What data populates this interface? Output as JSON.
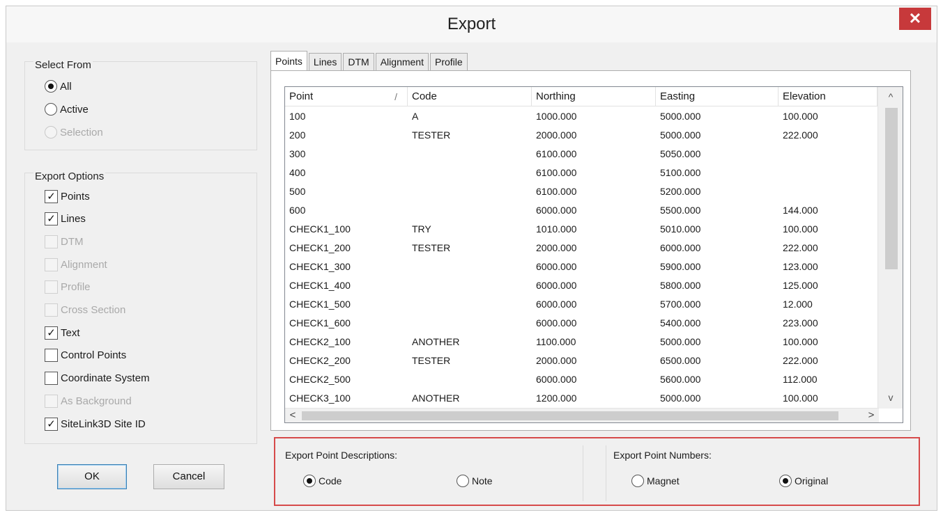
{
  "window": {
    "title": "Export",
    "close_glyph": "✕"
  },
  "select_from": {
    "label": "Select From",
    "options": [
      {
        "label": "All",
        "checked": true,
        "enabled": true
      },
      {
        "label": "Active",
        "checked": false,
        "enabled": true
      },
      {
        "label": "Selection",
        "checked": false,
        "enabled": false
      }
    ]
  },
  "export_options": {
    "label": "Export Options",
    "items": [
      {
        "label": "Points",
        "checked": true,
        "enabled": true
      },
      {
        "label": "Lines",
        "checked": true,
        "enabled": true
      },
      {
        "label": "DTM",
        "checked": false,
        "enabled": false
      },
      {
        "label": "Alignment",
        "checked": false,
        "enabled": false
      },
      {
        "label": "Profile",
        "checked": false,
        "enabled": false
      },
      {
        "label": "Cross Section",
        "checked": false,
        "enabled": false
      },
      {
        "label": "Text",
        "checked": true,
        "enabled": true
      },
      {
        "label": "Control Points",
        "checked": false,
        "enabled": true
      },
      {
        "label": "Coordinate System",
        "checked": false,
        "enabled": true
      },
      {
        "label": "As Background",
        "checked": false,
        "enabled": false
      },
      {
        "label": "SiteLink3D Site ID",
        "checked": true,
        "enabled": true
      }
    ]
  },
  "buttons": {
    "ok": "OK",
    "cancel": "Cancel"
  },
  "tabs": [
    "Points",
    "Lines",
    "DTM",
    "Alignment",
    "Profile"
  ],
  "active_tab": 0,
  "table": {
    "columns": [
      "Point",
      "Code",
      "Northing",
      "Easting",
      "Elevation"
    ],
    "sort_indicator": "/",
    "rows": [
      [
        "100",
        "A",
        "1000.000",
        "5000.000",
        "100.000"
      ],
      [
        "200",
        "TESTER",
        "2000.000",
        "5000.000",
        "222.000"
      ],
      [
        "300",
        "",
        "6100.000",
        "5050.000",
        ""
      ],
      [
        "400",
        "",
        "6100.000",
        "5100.000",
        ""
      ],
      [
        "500",
        "",
        "6100.000",
        "5200.000",
        ""
      ],
      [
        "600",
        "",
        "6000.000",
        "5500.000",
        "144.000"
      ],
      [
        "CHECK1_100",
        "TRY",
        "1010.000",
        "5010.000",
        "100.000"
      ],
      [
        "CHECK1_200",
        "TESTER",
        "2000.000",
        "6000.000",
        "222.000"
      ],
      [
        "CHECK1_300",
        "",
        "6000.000",
        "5900.000",
        "123.000"
      ],
      [
        "CHECK1_400",
        "",
        "6000.000",
        "5800.000",
        "125.000"
      ],
      [
        "CHECK1_500",
        "",
        "6000.000",
        "5700.000",
        "12.000"
      ],
      [
        "CHECK1_600",
        "",
        "6000.000",
        "5400.000",
        "223.000"
      ],
      [
        "CHECK2_100",
        "ANOTHER",
        "1100.000",
        "5000.000",
        "100.000"
      ],
      [
        "CHECK2_200",
        "TESTER",
        "2000.000",
        "6500.000",
        "222.000"
      ],
      [
        "CHECK2_500",
        "",
        "6000.000",
        "5600.000",
        "112.000"
      ],
      [
        "CHECK3_100",
        "ANOTHER",
        "1200.000",
        "5000.000",
        "100.000"
      ]
    ]
  },
  "scrollbar_glyphs": {
    "up": "^",
    "down": "v",
    "left": "<",
    "right": ">"
  },
  "point_descriptions": {
    "label": "Export Point Descriptions:",
    "options": [
      {
        "label": "Code",
        "checked": true
      },
      {
        "label": "Note",
        "checked": false
      }
    ]
  },
  "point_numbers": {
    "label": "Export Point Numbers:",
    "options": [
      {
        "label": "Magnet",
        "checked": false
      },
      {
        "label": "Original",
        "checked": true
      }
    ]
  },
  "colors": {
    "highlight_border": "#d64a4a",
    "close_button": "#c7393b"
  }
}
